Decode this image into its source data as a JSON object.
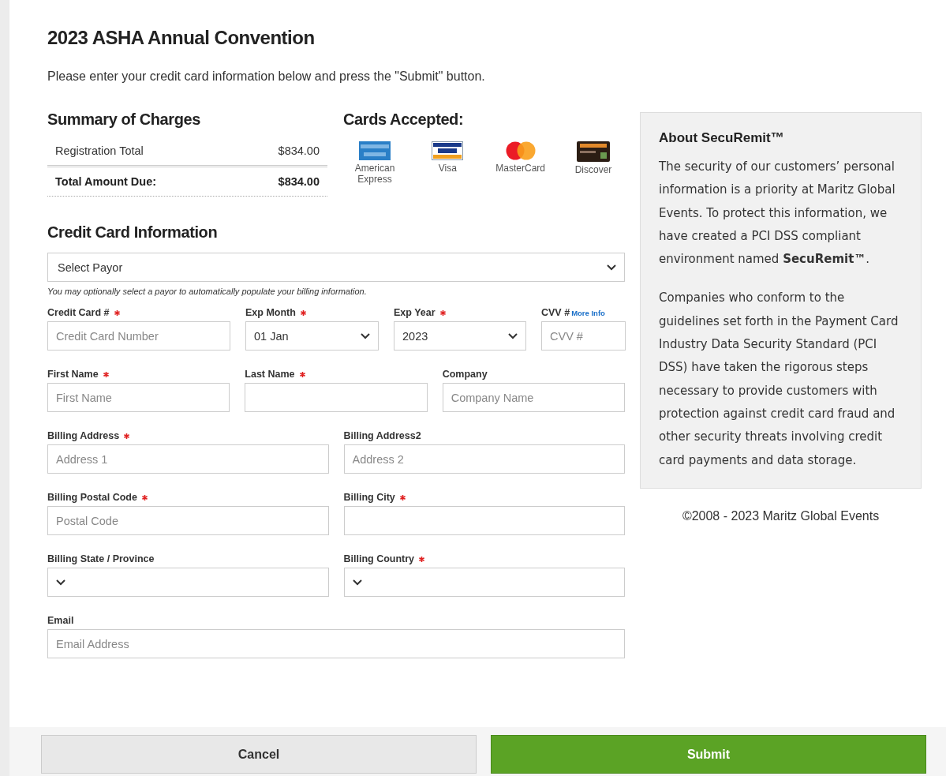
{
  "title": "2023 ASHA Annual Convention",
  "intro": "Please enter your credit card information below and press the \"Submit\" button.",
  "summary": {
    "heading": "Summary of Charges",
    "rows": [
      {
        "label": "Registration Total",
        "amount": "$834.00",
        "total": false
      },
      {
        "label": "Total Amount Due:",
        "amount": "$834.00",
        "total": true
      }
    ]
  },
  "cards": {
    "heading": "Cards Accepted:",
    "items": [
      {
        "kind": "amex",
        "name": "American Express"
      },
      {
        "kind": "visa",
        "name": "Visa"
      },
      {
        "kind": "mastercard",
        "name": "MasterCard"
      },
      {
        "kind": "discover",
        "name": "Discover"
      }
    ]
  },
  "credit_card_info": {
    "heading": "Credit Card Information",
    "payor": {
      "kind": "select",
      "value": "Select Payor"
    },
    "payor_hint": "You may optionally select a payor to automatically populate your billing information.",
    "rows": [
      [
        {
          "label": "Credit Card #",
          "required": true,
          "kind": "text",
          "placeholder": "Credit Card Number"
        },
        {
          "label": "Exp Month",
          "required": true,
          "kind": "select",
          "value": "01 Jan"
        },
        {
          "label": "Exp Year",
          "required": true,
          "kind": "select",
          "value": "2023"
        },
        {
          "label": "CVV #",
          "required": false,
          "link": "More Info",
          "kind": "text",
          "placeholder": "CVV #"
        }
      ],
      [
        {
          "label": "First Name",
          "required": true,
          "kind": "text",
          "placeholder": "First Name"
        },
        {
          "label": "Last Name",
          "required": true,
          "kind": "text"
        },
        {
          "label": "Company",
          "required": false,
          "kind": "text",
          "placeholder": "Company Name"
        }
      ],
      [
        {
          "label": "Billing Address",
          "required": true,
          "kind": "text",
          "placeholder": "Address 1"
        },
        {
          "label": "Billing Address2",
          "required": false,
          "kind": "text",
          "placeholder": "Address 2"
        }
      ],
      [
        {
          "label": "Billing Postal Code",
          "required": true,
          "kind": "text",
          "placeholder": "Postal Code"
        },
        {
          "label": "Billing City",
          "required": true,
          "kind": "text"
        }
      ],
      [
        {
          "label": "Billing State / Province",
          "required": false,
          "kind": "select"
        },
        {
          "label": "Billing Country",
          "required": true,
          "kind": "select"
        }
      ],
      [
        {
          "label": "Email",
          "required": false,
          "kind": "text",
          "placeholder": "Email Address"
        }
      ]
    ]
  },
  "about": {
    "heading": "About SecuRemit™",
    "paragraphs": [
      "The security of our customers’ personal information is a priority at Maritz Global Events. To protect this information, we have created a PCI DSS compliant environment named **SecuRemit™**.",
      "Companies who conform to the guidelines set forth in the Payment Card Industry Data Security Standard (PCI DSS) have taken the rigorous steps necessary to provide customers with protection against credit card fraud and other security threats involving credit card payments and data storage."
    ]
  },
  "copyright": "©2008 - 2023 Maritz Global Events",
  "buttons": [
    {
      "kind": "cancel",
      "label": "Cancel"
    },
    {
      "kind": "submit",
      "label": "Submit"
    }
  ]
}
